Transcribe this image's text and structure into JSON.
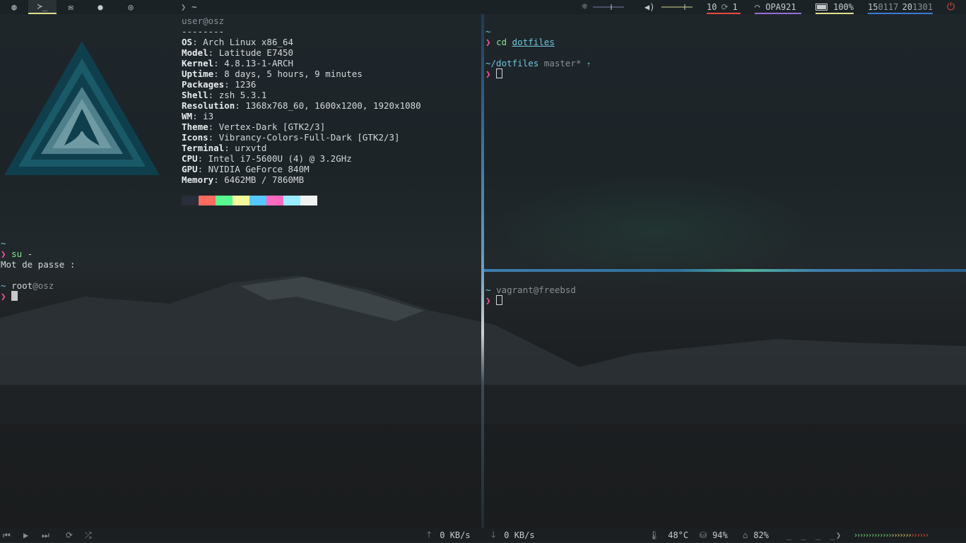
{
  "topbar": {
    "workspaces": [
      {
        "icon": "globe-icon",
        "glyph": "◍"
      },
      {
        "icon": "terminal-icon",
        "glyph": "≻_",
        "active": true
      },
      {
        "icon": "mail-icon",
        "glyph": "✉"
      },
      {
        "icon": "chat-icon",
        "glyph": "●"
      },
      {
        "icon": "gamepad-icon",
        "glyph": "◎"
      }
    ],
    "window_title": "~",
    "volume_level": 0.75,
    "updates_left": "10",
    "updates_right": "1",
    "wifi_ssid": "OPA921",
    "battery": "100%",
    "date": "15",
    "date_dim": "0117",
    "time": "20",
    "time_dim": "1301",
    "colors": {
      "updates": "#e74c3c",
      "wifi": "#9b6cd6",
      "battery": "#e2e08c",
      "clock": "#3a7bd5"
    }
  },
  "neofetch": {
    "user": "user",
    "host": "@osz",
    "sep": "--------",
    "rows": [
      {
        "k": "OS",
        "v": "Arch Linux x86_64"
      },
      {
        "k": "Model",
        "v": "Latitude E7450"
      },
      {
        "k": "Kernel",
        "v": "4.8.13-1-ARCH"
      },
      {
        "k": "Uptime",
        "v": "8 days, 5 hours, 9 minutes"
      },
      {
        "k": "Packages",
        "v": "1236"
      },
      {
        "k": "Shell",
        "v": "zsh 5.3.1"
      },
      {
        "k": "Resolution",
        "v": "1368x768_60, 1600x1200, 1920x1080"
      },
      {
        "k": "WM",
        "v": "i3"
      },
      {
        "k": "Theme",
        "v": "Vertex-Dark [GTK2/3]"
      },
      {
        "k": "Icons",
        "v": "Vibrancy-Colors-Full-Dark [GTK2/3]"
      },
      {
        "k": "Terminal",
        "v": "urxvtd"
      },
      {
        "k": "CPU",
        "v": "Intel i7-5600U (4) @ 3.2GHz"
      },
      {
        "k": "GPU",
        "v": "NVIDIA GeForce 840M"
      },
      {
        "k": "Memory",
        "v": "6462MB / 7860MB"
      }
    ],
    "palette": [
      "#2a2d3a",
      "#ff6b5e",
      "#5af78e",
      "#f3f99d",
      "#57c7ff",
      "#ff6ac1",
      "#9aedfe",
      "#f1f1f0"
    ]
  },
  "left_terminal": {
    "tilde": "~",
    "cmd": "su",
    "cmd_arg": " -",
    "prompt_glyph": "❯",
    "password_prompt": "Mot de passe :",
    "root_user": "root",
    "root_host": "@osz"
  },
  "right_top_terminal": {
    "tilde": "~",
    "cmd": "cd",
    "cmd_arg": "dotfiles",
    "path": "~/dotfiles",
    "branch": "master*",
    "arrow": "⇡",
    "prompt_glyph": "❯"
  },
  "right_bottom_terminal": {
    "tilde": "~",
    "user_host": "vagrant@freebsd",
    "prompt_glyph": "❯"
  },
  "bottombar": {
    "upload": "0 KB/s",
    "download": "0 KB/s",
    "temperature": "48°C",
    "disk": "94%",
    "home": "82%",
    "arrows": "››››››››››››››››››››››››››"
  }
}
